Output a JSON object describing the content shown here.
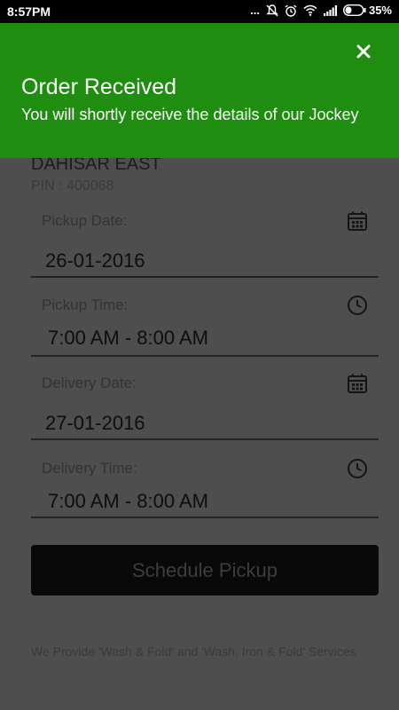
{
  "status_bar": {
    "time": "8:57PM",
    "dots": "...",
    "battery": "35%"
  },
  "notification": {
    "title": "Order Received",
    "message": "You will shortly receive the details of our Jockey"
  },
  "address": {
    "line": "DAHISAR EAST",
    "pin": "PIN : 400068"
  },
  "form": {
    "pickup_date": {
      "label": "Pickup Date:",
      "value": "26-01-2016"
    },
    "pickup_time": {
      "label": "Pickup Time:",
      "value": "7:00 AM - 8:00 AM"
    },
    "delivery_date": {
      "label": "Delivery Date:",
      "value": "27-01-2016"
    },
    "delivery_time": {
      "label": "Delivery Time:",
      "value": "7:00 AM - 8:00 AM"
    }
  },
  "button": {
    "label": "Schedule Pickup"
  },
  "footer": "We Provide 'Wash & Fold' and 'Wash, Iron & Fold' Services",
  "colors": {
    "banner": "#1e8d10",
    "overlay": "#4e4e4e",
    "button": "#090909"
  }
}
